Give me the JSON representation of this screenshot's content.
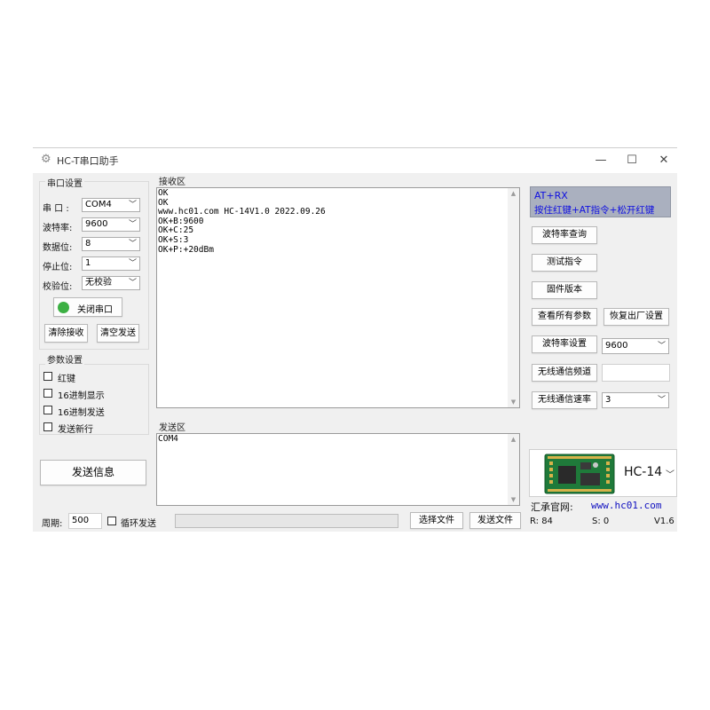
{
  "window": {
    "title": "HC-T串口助手",
    "controls": {
      "minimize": "—",
      "maximize": "☐",
      "close": "✕"
    }
  },
  "serial": {
    "group_label": "串口设置",
    "port_label": "串 口  :",
    "port_value": "COM4",
    "baud_label": "波特率:",
    "baud_value": "9600",
    "databits_label": "数据位:",
    "databits_value": "8",
    "stopbits_label": "停止位:",
    "stopbits_value": "1",
    "parity_label": "校验位:",
    "parity_value": "无校验",
    "close_port_label": "关闭串口",
    "status_color": "#3cb043",
    "clear_receive_label": "清除接收",
    "clear_send_label": "清空发送"
  },
  "params": {
    "group_label": "参数设置",
    "options": [
      "红键",
      "16进制显示",
      "16进制发送",
      "发送新行"
    ]
  },
  "send_info_label": "发送信息",
  "receive": {
    "group_label": "接收区",
    "text": "OK\nOK\nwww.hc01.com HC-14V1.0 2022.09.26\nOK+B:9600\nOK+C:25\nOK+S:3\nOK+P:+20dBm"
  },
  "send": {
    "group_label": "发送区",
    "text": "COM4"
  },
  "right_panel": {
    "at_line1": "AT+RX",
    "at_line2": "按住红键+AT指令+松开红键",
    "query_baud_label": "波特率查询",
    "test_cmd_label": "测试指令",
    "firmware_label": "固件版本",
    "view_all_label": "查看所有参数",
    "factory_reset_label": "恢复出厂设置",
    "set_baud_label": "波特率设置",
    "set_baud_value": "9600",
    "channel_label": "无线通信频道",
    "channel_value": "",
    "rate_label": "无线通信速率",
    "rate_value": "3",
    "module_name": "HC-14",
    "website_label": "汇承官网:",
    "website_url": "www.hc01.com"
  },
  "bottom": {
    "period_label": "周期:",
    "period_value": "500",
    "loop_send_label": "循环发送",
    "choose_file_label": "选择文件",
    "send_file_label": "发送文件",
    "rx_count": "R: 84",
    "tx_count": "S: 0",
    "version": "V1.6"
  },
  "colors": {
    "at_box_bg": "#aab0bf",
    "at_text": "#1010e0",
    "website": "#1010c0",
    "pcb_green": "#1f7a3a"
  }
}
